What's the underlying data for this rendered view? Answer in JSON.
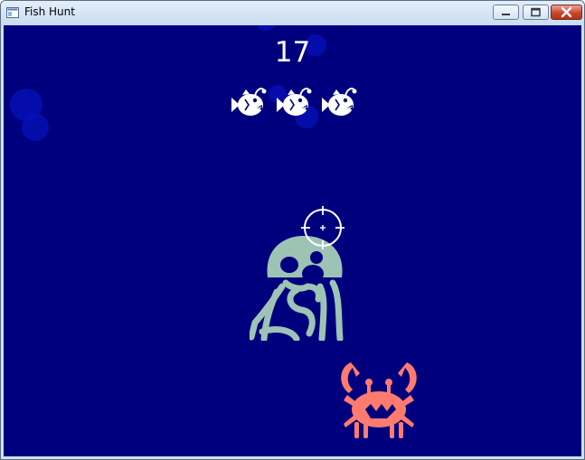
{
  "window": {
    "title": "Fish Hunt",
    "controls": {
      "minimize_icon": "minimize-icon",
      "maximize_icon": "maximize-icon",
      "close_icon": "close-icon"
    }
  },
  "game": {
    "score": "17",
    "lives_remaining": 3,
    "lives_icon": "fish-icon",
    "background_color": "#00007f",
    "bubble_color": "#0512b9",
    "jellyfish_color": "#9dc3b5",
    "crab_color": "#ff7b6e",
    "crosshair_color": "#ffffff"
  }
}
